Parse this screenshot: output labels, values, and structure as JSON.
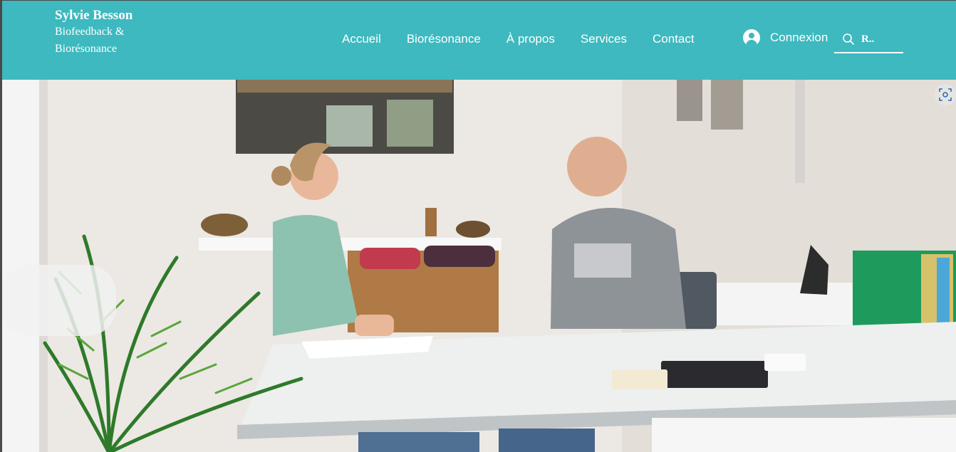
{
  "brand": {
    "name": "Sylvie Besson",
    "tagline": "Biofeedback & Biorésonance"
  },
  "nav": {
    "items": [
      {
        "label": "Accueil"
      },
      {
        "label": "Biorésonance"
      },
      {
        "label": "À propos"
      },
      {
        "label": "Services"
      },
      {
        "label": "Contact"
      }
    ]
  },
  "login": {
    "label": "Connexion",
    "icon": "user-avatar-icon"
  },
  "search": {
    "value": "R..",
    "icon": "search-icon"
  },
  "hero": {
    "alt": "",
    "icon": "visual-search-icon"
  },
  "colors": {
    "header_bg": "#3db9bf",
    "header_text": "#ffffff"
  }
}
